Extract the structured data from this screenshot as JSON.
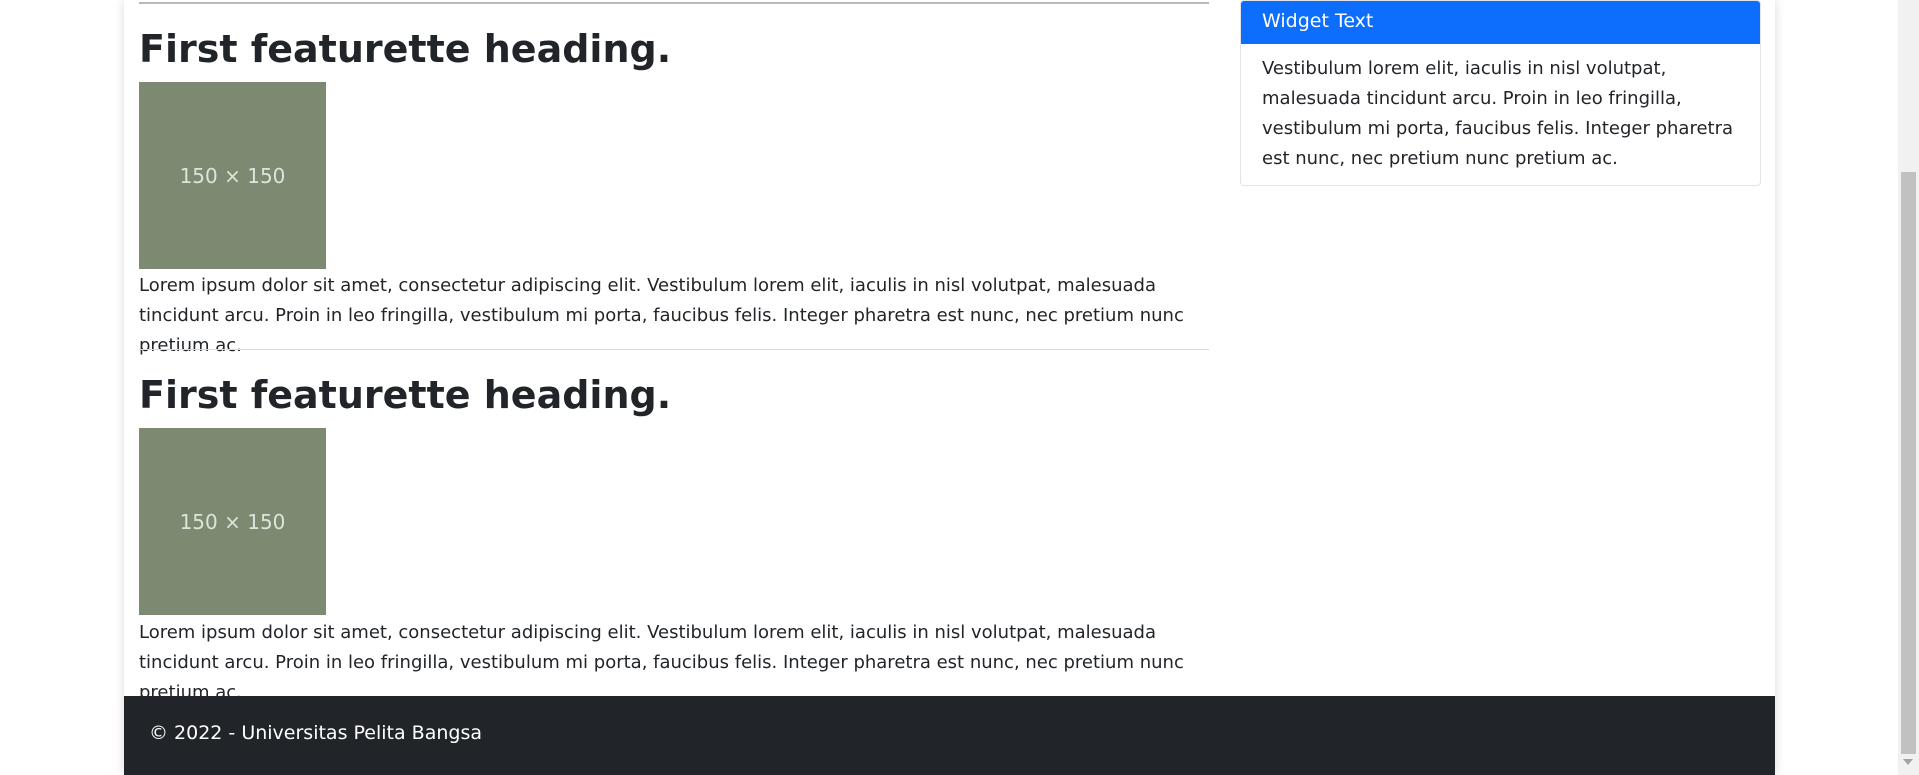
{
  "articles": [
    {
      "heading": "First featurette heading.",
      "image_label": "150 × 150",
      "text": "Lorem ipsum dolor sit amet, consectetur adipiscing elit. Vestibulum lorem elit, iaculis in nisl volutpat, malesuada tincidunt arcu. Proin in leo fringilla, vestibulum mi porta, faucibus felis. Integer pharetra est nunc, nec pretium nunc pretium ac."
    },
    {
      "heading": "First featurette heading.",
      "image_label": "150 × 150",
      "text": "Lorem ipsum dolor sit amet, consectetur adipiscing elit. Vestibulum lorem elit, iaculis in nisl volutpat, malesuada tincidunt arcu. Proin in leo fringilla, vestibulum mi porta, faucibus felis. Integer pharetra est nunc, nec pretium nunc pretium ac."
    }
  ],
  "widget": {
    "title": "Widget Text",
    "body": "Vestibulum lorem elit, iaculis in nisl volutpat, malesuada tincidunt arcu. Proin in leo fringilla, vestibulum mi porta, faucibus felis. Integer pharetra est nunc, nec pretium nunc pretium ac."
  },
  "footer": {
    "text": "© 2022 - Universitas Pelita Bangsa"
  },
  "colors": {
    "widget_header": "#0d6efd",
    "footer_bg": "#212529",
    "placeholder_bg": "#7b8a71"
  }
}
